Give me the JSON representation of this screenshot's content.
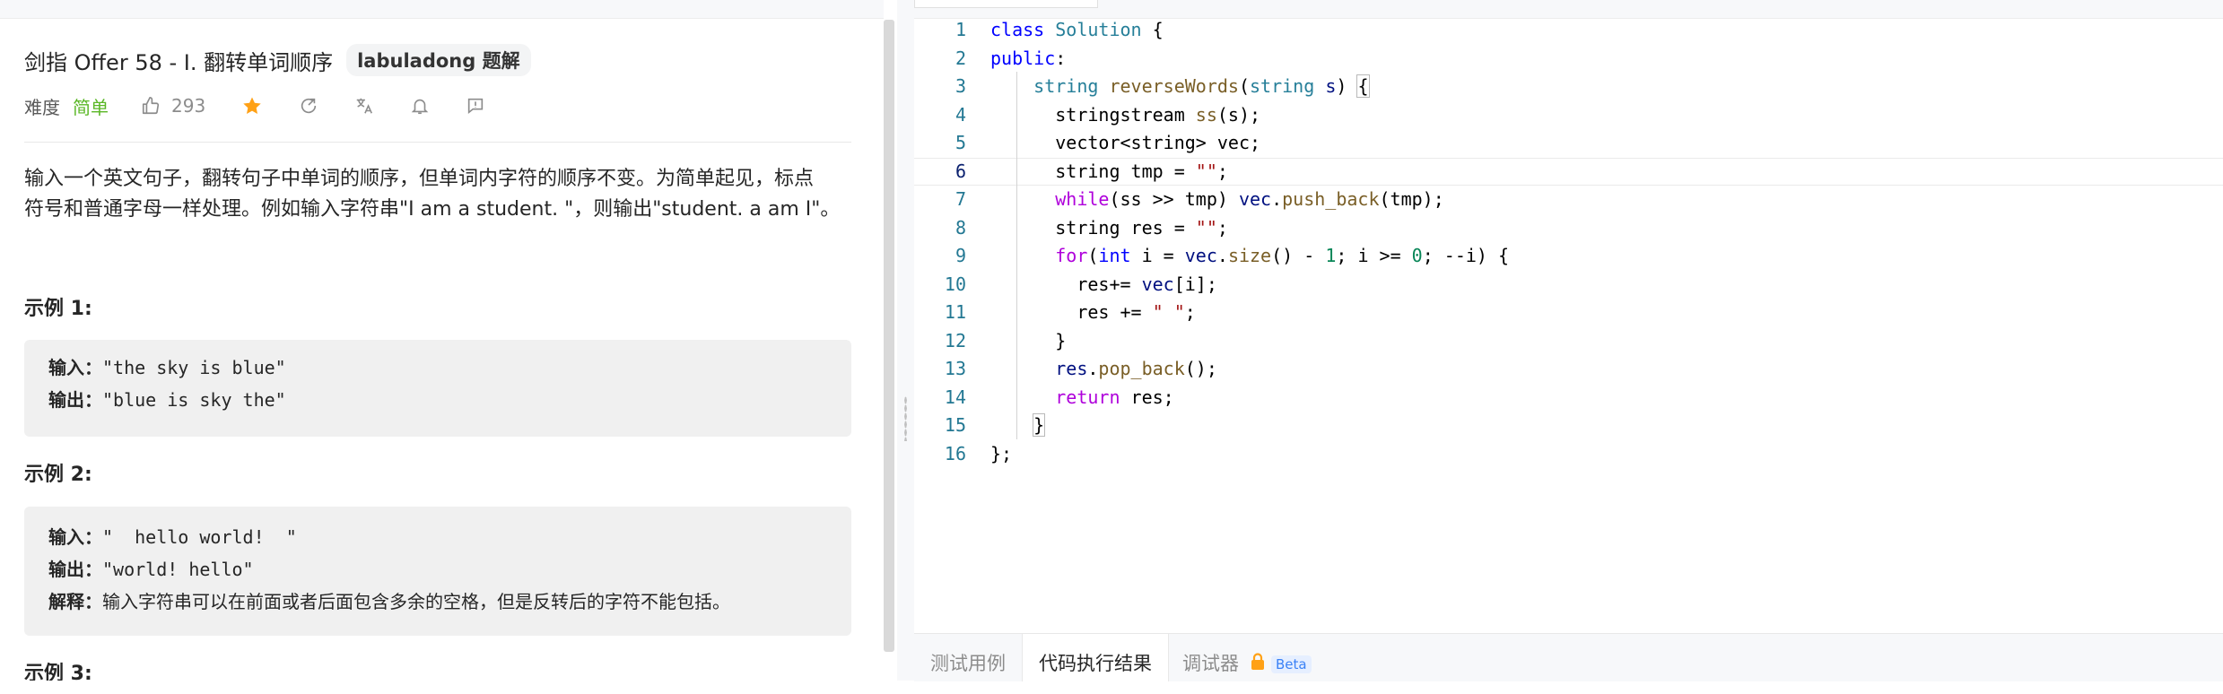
{
  "problem": {
    "title": "剑指 Offer 58 - I. 翻转单词顺序",
    "tag": "labuladong 题解",
    "difficulty_label": "难度",
    "difficulty": "简单",
    "likes": "293",
    "description_line1": "输入一个英文句子，翻转句子中单词的顺序，但单词内字符的顺序不变。为简单起见，标点",
    "description_line2": "符号和普通字母一样处理。例如输入字符串\"I am a student. \"，则输出\"student. a am I\"。",
    "examples": [
      {
        "title": "示例 1:",
        "input_label": "输入：",
        "input": "\"the sky is blue\"",
        "output_label": "输出：",
        "output": "\"blue is sky the\""
      },
      {
        "title": "示例 2:",
        "input_label": "输入：",
        "input": "\"  hello world!  \"",
        "output_label": "输出：",
        "output": "\"world! hello\"",
        "explain_label": "解释：",
        "explain": "输入字符串可以在前面或者后面包含多余的空格，但是反转后的字符不能包括。"
      },
      {
        "title": "示例 3:"
      }
    ]
  },
  "editor": {
    "line_numbers": [
      "1",
      "2",
      "3",
      "4",
      "5",
      "6",
      "7",
      "8",
      "9",
      "10",
      "11",
      "12",
      "13",
      "14",
      "15",
      "16"
    ],
    "active_line": "6"
  },
  "bottom_tabs": {
    "test_cases": "测试用例",
    "run_result": "代码执行结果",
    "debugger": "调试器",
    "beta": "Beta"
  },
  "colors": {
    "accent_green": "#5ab726",
    "star_orange": "#ffa116",
    "keyword_blue": "#0000ff",
    "type_teal": "#267f99",
    "string_red": "#a31515",
    "number_green": "#098658",
    "control_purple": "#af00db",
    "function_brown": "#795e26"
  },
  "icons": [
    "thumbs-up-icon",
    "star-icon",
    "share-icon",
    "translate-icon",
    "bell-icon",
    "feedback-icon",
    "lock-icon"
  ]
}
